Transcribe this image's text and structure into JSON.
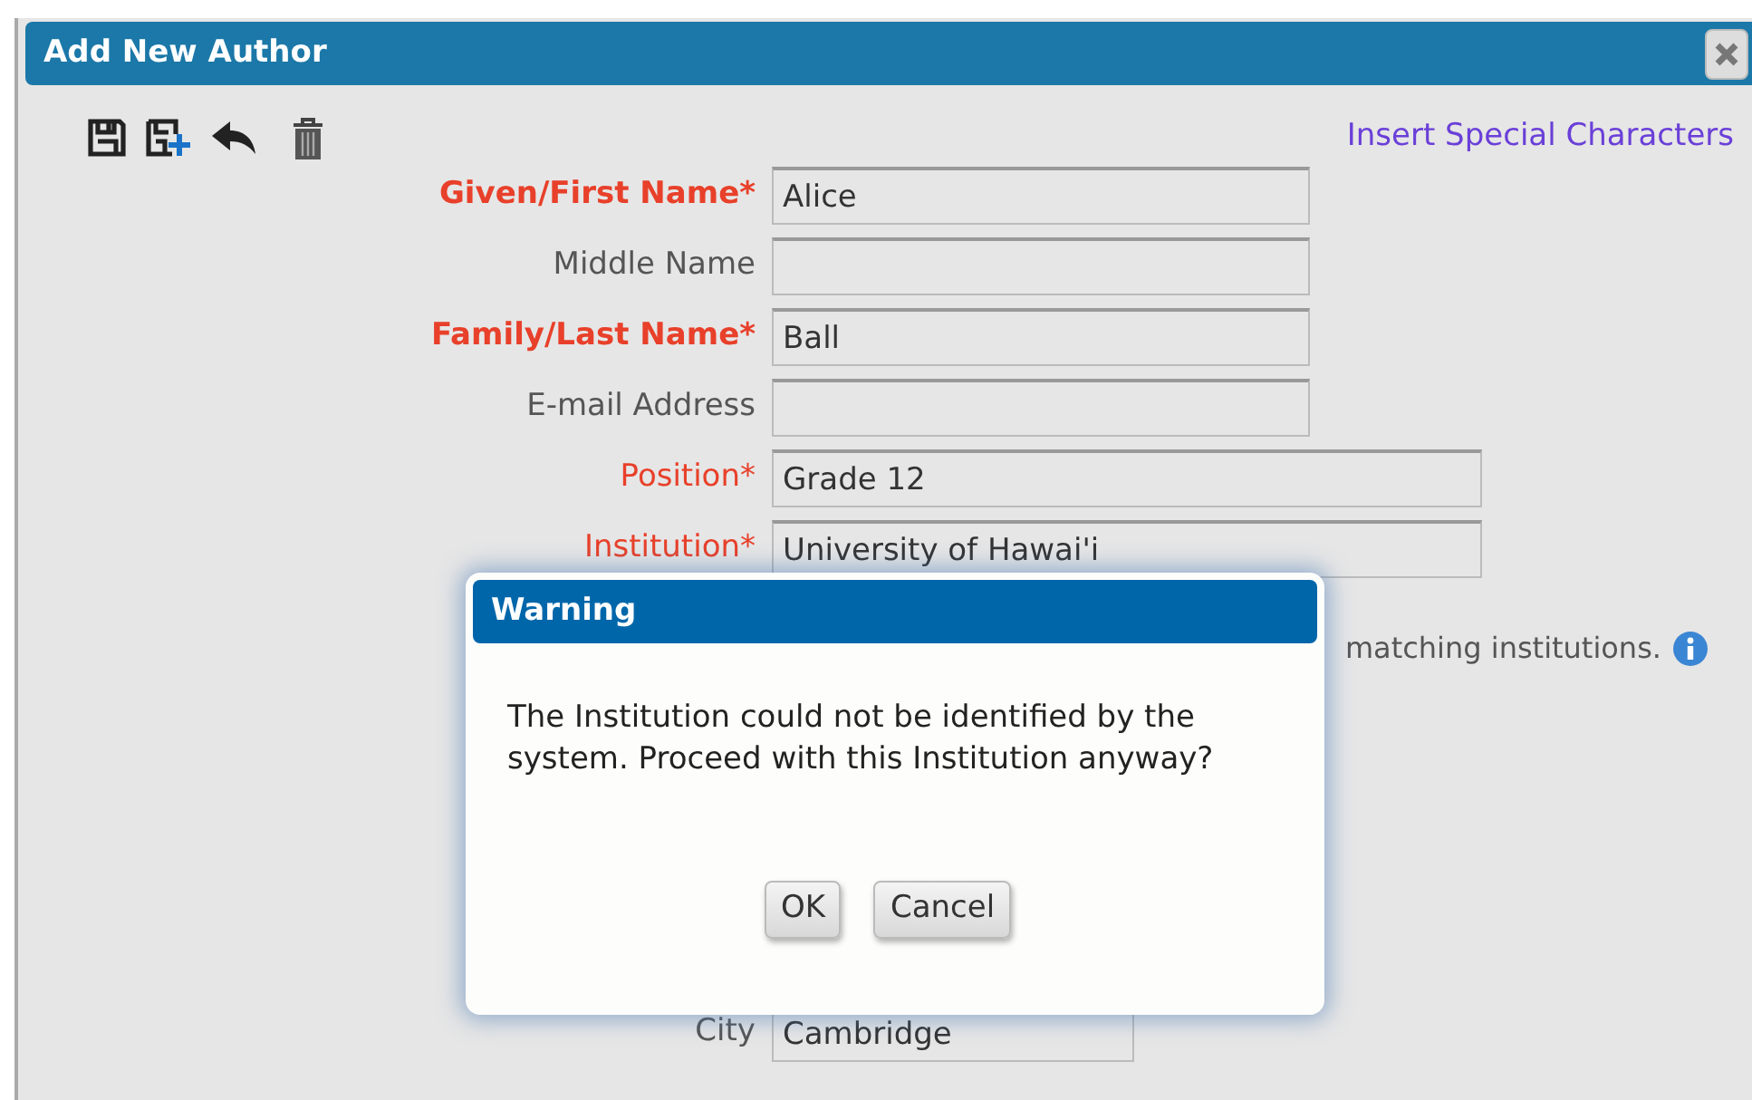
{
  "window": {
    "title": "Add New Author"
  },
  "link": "Insert Special Characters",
  "fields": [
    {
      "label": "Given/First Name*",
      "required": true,
      "bold": true,
      "kind": "short",
      "value": "Alice"
    },
    {
      "label": "Middle Name",
      "required": false,
      "bold": false,
      "kind": "short"
    },
    {
      "label": "Family/Last Name*",
      "required": true,
      "bold": true,
      "kind": "short",
      "value": "Ball"
    },
    {
      "label": "E-mail Address",
      "required": false,
      "bold": false,
      "kind": "short"
    },
    {
      "label": "Position*",
      "required": true,
      "bold": false,
      "kind": "long",
      "value": "Grade 12"
    },
    {
      "label": "Institution*",
      "required": true,
      "bold": false,
      "kind": "long",
      "value": "University of Hawai'i"
    }
  ],
  "note": "matching institutions.",
  "address_fields": [
    {
      "label": "City",
      "required": false,
      "bold": false,
      "kind": "medium",
      "value": "Cambridge"
    }
  ],
  "dialog": {
    "title": "Warning",
    "message": "The Institution could not be identified by the system. Proceed with this Institution anyway?",
    "buttons": [
      "OK",
      "Cancel"
    ]
  }
}
